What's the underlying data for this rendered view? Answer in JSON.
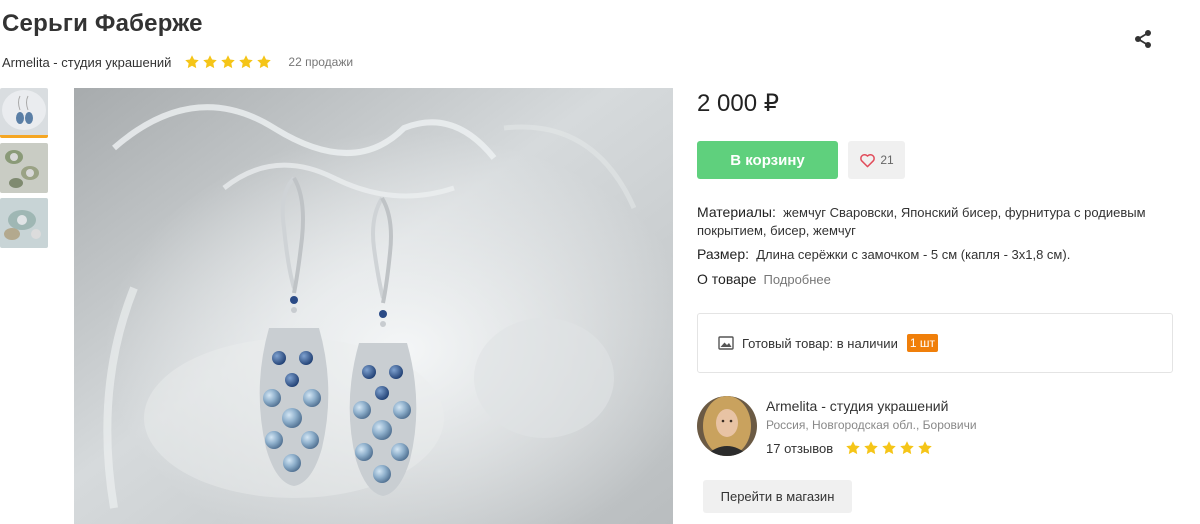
{
  "product": {
    "title": "Серьги Фаберже",
    "shop_name": "Armelita - студия украшений",
    "rating": 5,
    "sales": "22 продажи",
    "price": "2 000 ₽",
    "add_to_cart": "В корзину",
    "favorites_count": "21",
    "materials_label": "Материалы:",
    "materials_value": "жемчуг Сваровски, Японский бисер, фурнитура с родиевым покрытием, бисер, жемчуг",
    "size_label": "Размер:",
    "size_value": "Длина серёжки с замочком - 5 см (капля - 3х1,8 см).",
    "about_label": "О товаре",
    "about_link": "Подробнее",
    "stock_text": "Готовый товар: в наличии",
    "stock_badge": "1 шт"
  },
  "seller": {
    "name": "Armelita - студия украшений",
    "location": "Россия, Новгородская обл., Боровичи",
    "reviews": "17 отзывов",
    "rating": 5,
    "shop_button": "Перейти в магазин"
  },
  "icons": {
    "share": "share-icon",
    "star": "star-icon",
    "heart": "heart-icon",
    "stock": "image-icon"
  },
  "colors": {
    "star": "#f5c518",
    "cart_button": "#5fd07d",
    "stock_badge": "#f07f0a",
    "thumb_active": "#f5a623",
    "heart": "#e14b5a"
  }
}
